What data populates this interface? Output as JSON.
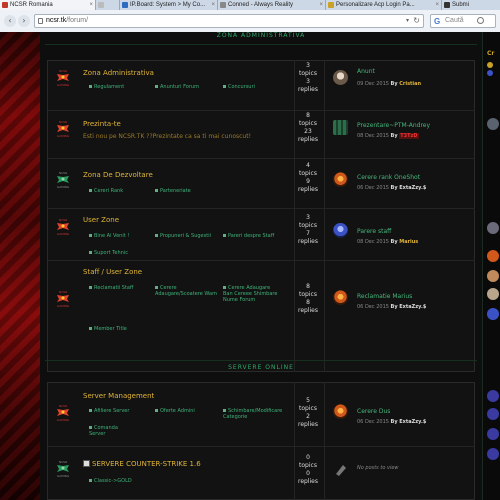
{
  "tabs": [
    {
      "label": "NCSR Romania",
      "color": "#c0392b",
      "active": true
    },
    {
      "label": "Post Review Test",
      "color": "#cccccc"
    },
    {
      "label": "IP.Board: System > My Co...",
      "color": "#2d6cc0"
    },
    {
      "label": "Conned - Always Reality",
      "color": "#888888"
    },
    {
      "label": "Personalizare Acp Login Pa...",
      "color": "#c9a227"
    },
    {
      "label": "Submi",
      "color": "#333333"
    }
  ],
  "address": {
    "domain": "ncsr.tk",
    "path": "/forum/"
  },
  "search": {
    "placeholder": "Caută"
  },
  "sidebar": {
    "title": "Cr"
  },
  "categories": [
    {
      "title": "ZONA ADMINISTRATIVA"
    },
    {
      "title": "SERVERE ONLINE"
    }
  ],
  "forums": [
    {
      "title": "Zona Administrativa",
      "desc": "",
      "subforums": [
        "Regulament",
        "Anunturi Forum",
        "Concursuri"
      ],
      "topics": "3",
      "topics_label": "topics",
      "replies": "3",
      "replies_label": "replies",
      "last_title": "Anunt",
      "last_date": "09 Dec 2015",
      "last_by": "By",
      "last_user": "Cristian",
      "user_style": "u1",
      "avatar": "#b8a58a"
    },
    {
      "title": "Prezinta-te",
      "desc": "Esti nou pe NCSR.TK ??Prezintate ca sa ti mai cunoscut!",
      "subforums": [],
      "topics": "8",
      "topics_label": "topics",
      "replies": "23",
      "replies_label": "replies",
      "last_title": "Prezentare~PTM-Andrey",
      "last_date": "08 Dec 2015",
      "last_by": "By",
      "last_user": "T3TzD",
      "user_style": "u2",
      "avatar": "#2c6e4a"
    },
    {
      "title": "Zona De Dezvoltare",
      "desc": "",
      "subforums": [
        "Cereri Rank",
        "Parteneriate"
      ],
      "topics": "4",
      "topics_label": "topics",
      "replies": "9",
      "replies_label": "replies",
      "last_title": "Cerere rank OneShot",
      "last_date": "06 Dec 2015",
      "last_by": "By",
      "last_user": "ExtaZzy.$",
      "user_style": "u3",
      "avatar": "#d0581a"
    },
    {
      "title": "User Zone",
      "desc": "",
      "subforums": [
        "Bine Ai Venit !",
        "Propuneri & Sugestii",
        "Pareri despre Staff",
        "Suport Tehnic"
      ],
      "topics": "3",
      "topics_label": "topics",
      "replies": "7",
      "replies_label": "replies",
      "last_title": "Parere staff",
      "last_date": "08 Dec 2015",
      "last_by": "By",
      "last_user": "Marius",
      "user_style": "u1",
      "avatar": "#3a52c6"
    },
    {
      "title": "Staff / User Zone",
      "desc": "",
      "subforums": [
        "Reclamatii Staff",
        "Cerere Adaugare/Scoatere Wam",
        "Cerere Adaugare Ban Cereee Shimbare Nume Forum",
        "Member Title"
      ],
      "topics": "8",
      "topics_label": "topics",
      "replies": "8",
      "replies_label": "replies",
      "last_title": "Reclamatie Marius",
      "last_date": "06 Dec 2015",
      "last_by": "By",
      "last_user": "ExtaZzy.$",
      "user_style": "u3",
      "avatar": "#d0581a"
    },
    {
      "title": "Server Management",
      "desc": "",
      "subforums": [
        "Afiliere Server",
        "Oferte Admini",
        "Schimbare/Modificare Categorie",
        "Comanda Server"
      ],
      "topics": "5",
      "topics_label": "topics",
      "replies": "2",
      "replies_label": "replies",
      "last_title": "Cerere Dus",
      "last_date": "06 Dec 2015",
      "last_by": "By",
      "last_user": "ExtaZzy.$",
      "user_style": "u3",
      "avatar": "#d0581a"
    },
    {
      "title": "SERVERE COUNTER-STRIKE 1.6",
      "desc": "",
      "subforums": [
        "Classic->GOLD"
      ],
      "topics": "0",
      "topics_label": "topics",
      "replies": "0",
      "replies_label": "replies",
      "no_posts": "No posts to view"
    }
  ]
}
